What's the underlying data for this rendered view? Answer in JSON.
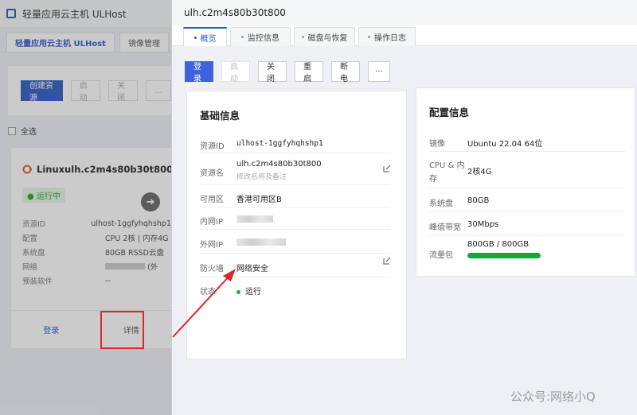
{
  "background_page": {
    "app_title": "轻量应用云主机 ULHost",
    "tabs": [
      {
        "label": "轻量应用云主机 ULHost"
      },
      {
        "label": "镜像管理"
      }
    ],
    "toolbar": {
      "create": "创建资源",
      "start": "启动",
      "stop": "关闭",
      "more": "..."
    },
    "select_all": "全选",
    "card": {
      "name": "Linuxulh.c2m4s80b30t800",
      "status": "运行中",
      "rows": [
        {
          "label": "资源ID",
          "value": "ulhost-1ggfyhqhshp1"
        },
        {
          "label": "配置",
          "value": "CPU 2核 | 内存4G"
        },
        {
          "label": "系统盘",
          "value": "80GB RSSD云盘"
        },
        {
          "label": "网络",
          "value": "(外"
        },
        {
          "label": "预装软件",
          "value": "--"
        }
      ],
      "login": "登录",
      "detail": "详情"
    }
  },
  "drawer": {
    "title": "ulh.c2m4s80b30t800",
    "tabs": [
      "概览",
      "监控信息",
      "磁盘与恢复",
      "操作日志"
    ],
    "actions": {
      "login": "登录",
      "start": "启动",
      "stop": "关闭",
      "restart": "重启",
      "poweroff": "断电",
      "more": "···"
    },
    "basic": {
      "title": "基础信息",
      "resource_id_label": "资源ID",
      "resource_id": "ulhost-1ggfyhqhshp1",
      "name_label": "资源名",
      "name": "ulh.c2m4s80b30t800",
      "name_hint": "修改名称及备注",
      "zone_label": "可用区",
      "zone": "香港可用区B",
      "private_ip_label": "内网IP",
      "public_ip_label": "外网IP",
      "firewall_label": "防火墙",
      "firewall": "网络安全",
      "status_label": "状态",
      "status": "运行"
    },
    "config": {
      "title": "配置信息",
      "image_label": "镜像",
      "image": "Ubuntu 22.04 64位",
      "cpu_label_1": "CPU & 内",
      "cpu_label_2": "存",
      "cpu": "2核4G",
      "disk_label": "系统盘",
      "disk": "80GB",
      "bandwidth_label": "峰值带宽",
      "bandwidth": "30Mbps",
      "traffic_label": "流量包",
      "traffic": "800GB / 800GB",
      "traffic_fraction": 1.0
    }
  },
  "watermark": "公众号:网络小Q",
  "colors": {
    "primary": "#3d63de",
    "running": "#22aa33",
    "progress": "#18a53a",
    "highlight": "#e0262b"
  }
}
